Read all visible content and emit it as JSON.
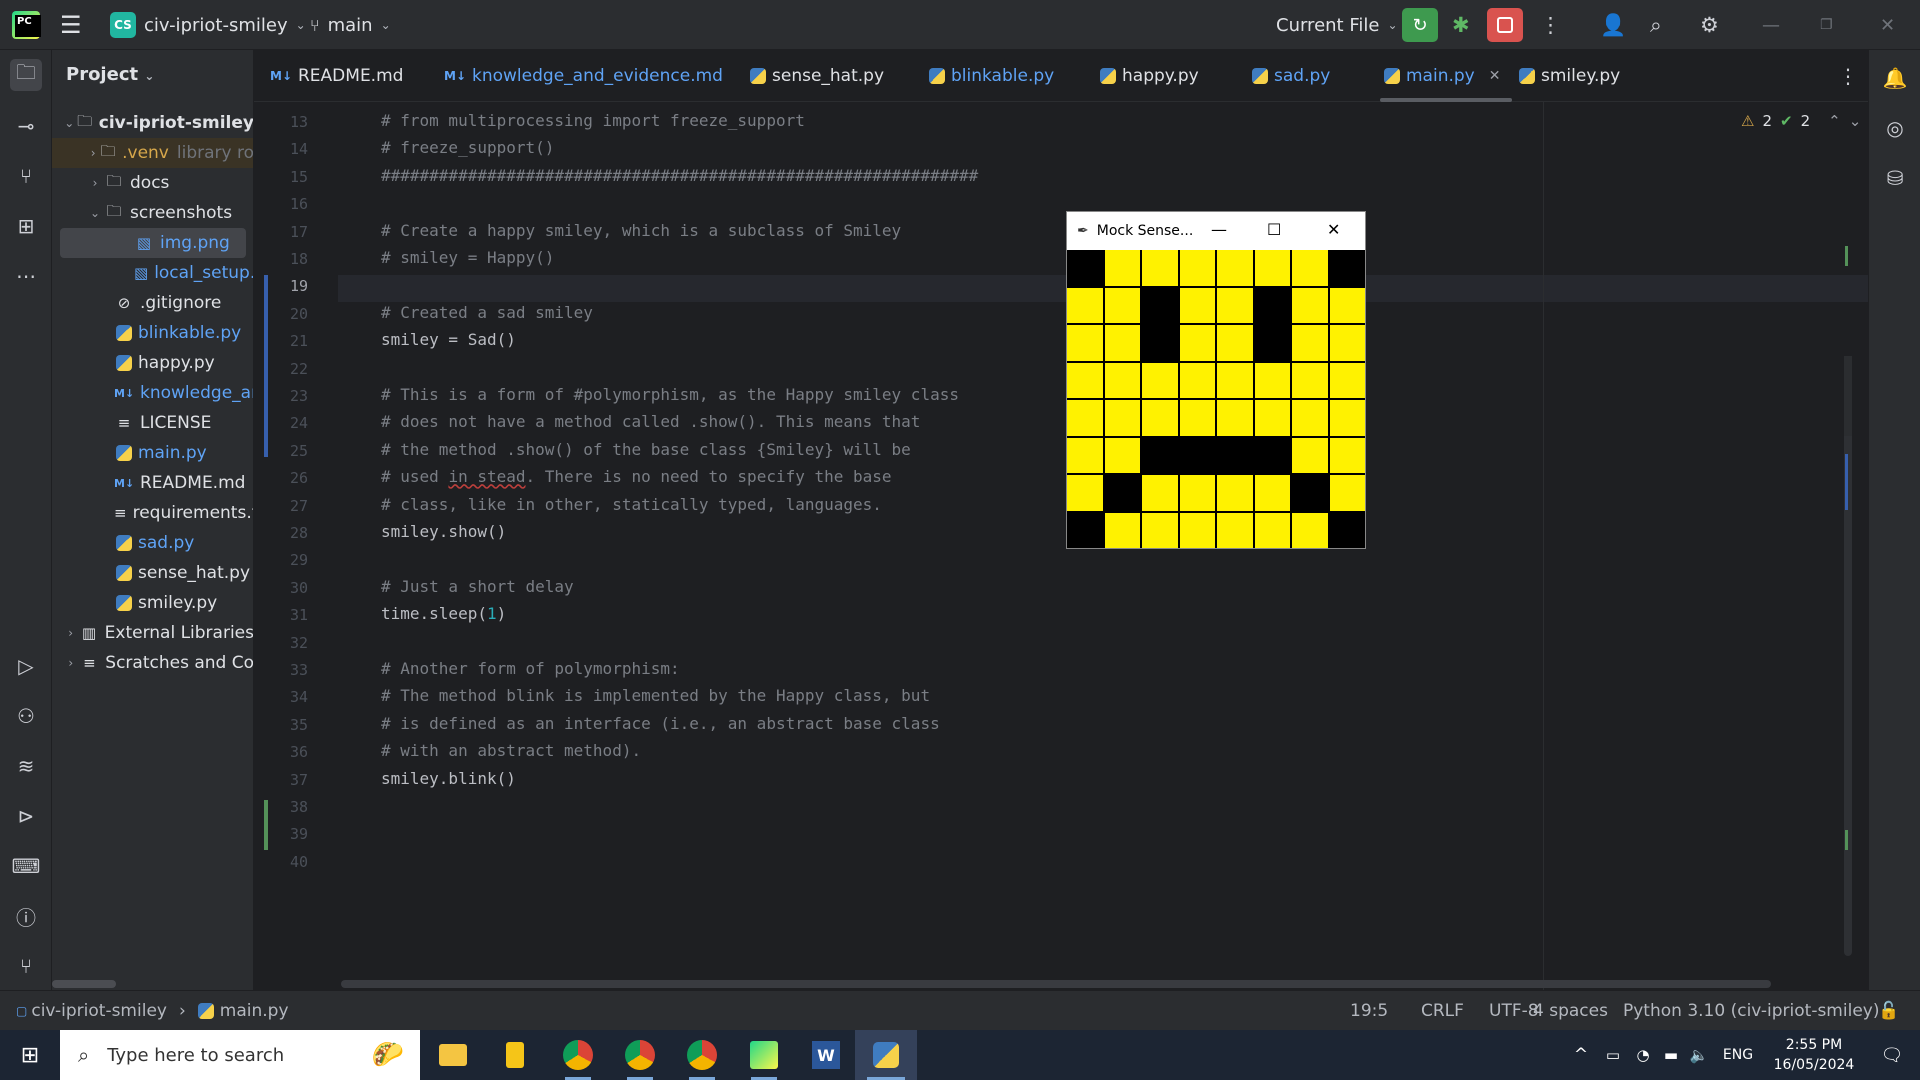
{
  "titlebar": {
    "project_badge": "CS",
    "project_name": "civ-ipriot-smiley",
    "branch": "main",
    "run_config": "Current File"
  },
  "project_panel": {
    "header": "Project",
    "root": "civ-ipriot-smiley",
    "items": [
      {
        "label": ".venv",
        "suffix": "library ro"
      },
      {
        "label": "docs"
      },
      {
        "label": "screenshots"
      },
      {
        "label": "img.png"
      },
      {
        "label": "local_setup."
      },
      {
        "label": ".gitignore"
      },
      {
        "label": "blinkable.py"
      },
      {
        "label": "happy.py"
      },
      {
        "label": "knowledge_and"
      },
      {
        "label": "LICENSE"
      },
      {
        "label": "main.py"
      },
      {
        "label": "README.md"
      },
      {
        "label": "requirements.tx"
      },
      {
        "label": "sad.py"
      },
      {
        "label": "sense_hat.py"
      },
      {
        "label": "smiley.py"
      },
      {
        "label": "External Libraries"
      },
      {
        "label": "Scratches and Co"
      }
    ]
  },
  "tabs": [
    {
      "label": "README.md",
      "md": "M↓"
    },
    {
      "label": "knowledge_and_evidence.md",
      "md": "M↓"
    },
    {
      "label": "sense_hat.py"
    },
    {
      "label": "blinkable.py"
    },
    {
      "label": "happy.py"
    },
    {
      "label": "sad.py"
    },
    {
      "label": "main.py"
    },
    {
      "label": "smiley.py"
    }
  ],
  "inspections": {
    "warnings": "2",
    "ok": "2"
  },
  "editor": {
    "line_numbers": [
      "13",
      "14",
      "15",
      "16",
      "17",
      "18",
      "19",
      "20",
      "21",
      "22",
      "23",
      "24",
      "25",
      "26",
      "27",
      "28",
      "29",
      "30",
      "31",
      "32",
      "33",
      "34",
      "35",
      "36",
      "37",
      "38",
      "39",
      "40"
    ],
    "lines": [
      "# from multiprocessing import freeze_support",
      "# freeze_support()",
      "##############################################################",
      "",
      "# Create a happy smiley, which is a subclass of Smiley",
      "# smiley = Happy()",
      "",
      "# Created a sad smiley",
      "smiley = Sad()",
      "",
      "# This is a form of #polymorphism, as the Happy smiley class",
      "# does not have a method called .show(). This means that",
      "# the method .show() of the base class {Smiley} will be",
      "# used in stead. There is no need to specify the base",
      "# class, like in other, statically typed, languages.",
      "smiley.show()",
      "",
      "# Just a short delay",
      "time.sleep(",
      "",
      "# Another form of polymorphism:",
      "# The method blink is implemented by the Happy class, but",
      "# is defined as an interface (i.e., an abstract base class",
      "# with an abstract method).",
      "smiley.blink()",
      "",
      "",
      ""
    ],
    "line26_pre": "# used ",
    "line26_squig": "in stead",
    "line26_post": ". There is no need to specify the base",
    "sleep_arg": "1",
    "sleep_close": ")"
  },
  "mock_window": {
    "title": "Mock Sense...",
    "pixels": [
      [
        0,
        1,
        1,
        1,
        1,
        1,
        1,
        0
      ],
      [
        1,
        1,
        0,
        1,
        1,
        0,
        1,
        1
      ],
      [
        1,
        1,
        0,
        1,
        1,
        0,
        1,
        1
      ],
      [
        1,
        1,
        1,
        1,
        1,
        1,
        1,
        1
      ],
      [
        1,
        1,
        1,
        1,
        1,
        1,
        1,
        1
      ],
      [
        1,
        1,
        0,
        0,
        0,
        0,
        1,
        1
      ],
      [
        1,
        0,
        1,
        1,
        1,
        1,
        0,
        1
      ],
      [
        0,
        1,
        1,
        1,
        1,
        1,
        1,
        0
      ]
    ],
    "on_color": "#fff200",
    "off_color": "#000000"
  },
  "statusbar": {
    "breadcrumb_project": "civ-ipriot-smiley",
    "breadcrumb_file": "main.py",
    "position": "19:5",
    "line_sep": "CRLF",
    "encoding": "UTF-8",
    "indent": "4 spaces",
    "interpreter": "Python 3.10 (civ-ipriot-smiley)"
  },
  "taskbar": {
    "search_placeholder": "Type here to search",
    "lang": "ENG",
    "time": "2:55 PM",
    "date": "16/05/2024"
  }
}
